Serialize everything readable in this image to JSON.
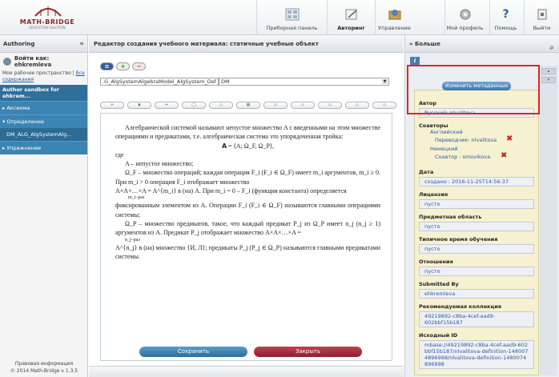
{
  "header": {
    "logo": {
      "name": "MATH-BRIDGE",
      "tagline": "EDUCATION SOLUTION"
    },
    "nav": [
      {
        "label": "Приборная панель",
        "icon": "dashboard-icon"
      },
      {
        "label": "Авторинг",
        "icon": "authoring-icon",
        "active": true
      },
      {
        "label": "Управление",
        "icon": "management-icon"
      },
      {
        "label": "Мой профиль",
        "icon": "profile-icon"
      },
      {
        "label": "Помощь",
        "icon": "help-icon"
      },
      {
        "label": "Выйти",
        "icon": "logout-icon"
      }
    ]
  },
  "left": {
    "title": "Authoring",
    "login": "Войти как: ehkremleva",
    "workspace_prefix": "Мое рабочее пространство | ",
    "workspace_link": "Все содержания",
    "sandbox_title": "Author sandbox for ehkrem...",
    "items": [
      {
        "label": "▸ Аксиома"
      },
      {
        "label": "▾ Определение"
      },
      {
        "label": "DM_ALG_AlgSystemAlg...",
        "sub": true
      },
      {
        "label": "▸ Упражнение"
      }
    ],
    "footer_line1": "Правовая информация",
    "footer_line2": "© 2014 Math-Bridge v 1.3.5"
  },
  "editor": {
    "title": "Редактор создания учебного материала: статичные учебные объект",
    "select_id": ".G_AlgSystemAlgebraModel_AlgSystem_Def",
    "select_lang": "DM",
    "toolbar_icons": [
      "plus",
      "add-row",
      "link",
      "omdoc",
      "image",
      "table",
      "math",
      "formula",
      "code",
      "preview",
      "source"
    ],
    "paragraphs": [
      "Алгебраической системой называют непустое множество A с введенными на этом множестве операциями и предикатами, т.е. алгебраическая система это упорядоченная тройка:",
      "𝗔 = ⟨A; Ω_F, Ω_P⟩,",
      "где",
      "A – непустое множество;",
      "Ω_F – множество операций; каждая операция F_i (F_i ∈ Ω_F) имеет m_i аргументов, m_i ≥ 0. При m_i > 0 операция F_i отображает множество",
      "A×A×…×A = A^{m_i} в (на) A. При m_i = 0 – F_i (функция константа) определяется",
      "m_i–раз",
      "фиксированным элементом из A. Операции F_i (F_i ∈ Ω_F) называются главными операциями системы;",
      "Ω_P – множество предикатов, такое, что каждый предикат P_j из Ω_P имеет n_j (n_j ≥ 1) аргументов из A. Предикат P_j отображает множество A×A×…×A =",
      "n_j–раз",
      "A^{n_j} в (на) множество {И, Л}; предикаты P_j (P_j ∈ Ω_P) называются главными предикатами системы."
    ],
    "save_label": "Сохранить",
    "close_label": "Закрыть"
  },
  "right": {
    "title": "Больше",
    "edit_button": "Изменить метаданные",
    "author_label": "Автор",
    "author_value": "Русский: nlvalitova",
    "coauthors_label": "Соавторы",
    "coauthors": [
      {
        "lang": "Английский",
        "role": "Переводчик: nlvalitova"
      },
      {
        "lang": "Немецкий",
        "role": "Соавтор : smovikova"
      }
    ],
    "date_label": "Дата",
    "date_value": "создано : 2016-11-25T14:56:37",
    "license_label": "Лицензия",
    "license_value": "пусто",
    "subject_label": "Предметная область",
    "subject_value": "пусто",
    "time_label": "Типичное время обучения",
    "time_value": "пусто",
    "relations_label": "Отношения",
    "relations_value": "пусто",
    "submitted_label": "Submitted By",
    "submitted_value": "ehkremleva",
    "collection_label": "Рекомендуемая коллекция",
    "collection_value": "49219892-c8ba-4cef-aad9-602bbf15b187",
    "source_label": "Исходный ID",
    "source_value": "mbase://49219892-c8ba-4cef-aad9-602bbf15b187/nlvalitova-definition-1480074896998/nlvalitova-definition-1480074896998"
  },
  "colors": {
    "header_bg": "#eceff3",
    "sidebar_blue": "#3b84b3",
    "metadata_bg": "#f6f1d0",
    "highlight_red": "#d9262f",
    "save_blue": "#2e6c9c",
    "close_red": "#8c1f2c"
  }
}
